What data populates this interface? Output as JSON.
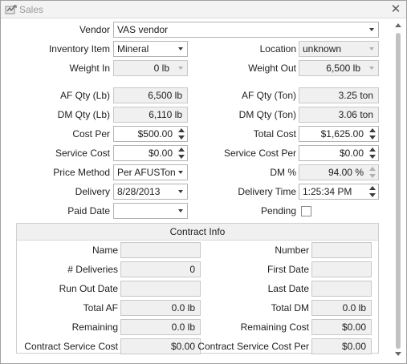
{
  "window": {
    "title": "Sales",
    "title_icon": "sales-form-icon",
    "close_icon": "close-icon"
  },
  "fields": {
    "vendor": {
      "label": "Vendor",
      "value": "VAS vendor"
    },
    "inventory_item": {
      "label": "Inventory Item",
      "value": "Mineral"
    },
    "location": {
      "label": "Location",
      "value": "unknown"
    },
    "weight_in": {
      "label": "Weight In",
      "value": "0 lb"
    },
    "weight_out": {
      "label": "Weight Out",
      "value": "6,500 lb"
    },
    "af_qty_lb": {
      "label": "AF Qty (Lb)",
      "value": "6,500 lb"
    },
    "af_qty_ton": {
      "label": "AF Qty (Ton)",
      "value": "3.25 ton"
    },
    "dm_qty_lb": {
      "label": "DM Qty (Lb)",
      "value": "6,110 lb"
    },
    "dm_qty_ton": {
      "label": "DM Qty (Ton)",
      "value": "3.06 ton"
    },
    "cost_per": {
      "label": "Cost Per",
      "value": "$500.00"
    },
    "total_cost": {
      "label": "Total Cost",
      "value": "$1,625.00"
    },
    "service_cost": {
      "label": "Service Cost",
      "value": "$0.00"
    },
    "service_cost_per": {
      "label": "Service Cost Per",
      "value": "$0.00"
    },
    "price_method": {
      "label": "Price Method",
      "value": "Per AFUSTon"
    },
    "dm_percent": {
      "label": "DM %",
      "value": "94.00 %"
    },
    "delivery": {
      "label": "Delivery",
      "value": "8/28/2013"
    },
    "delivery_time": {
      "label": "Delivery Time",
      "value": "1:25:34 PM"
    },
    "paid_date": {
      "label": "Paid Date",
      "value": ""
    },
    "pending": {
      "label": "Pending",
      "checked": false
    }
  },
  "contract_info": {
    "title": "Contract Info",
    "name": {
      "label": "Name",
      "value": ""
    },
    "number": {
      "label": "Number",
      "value": ""
    },
    "deliveries": {
      "label": "# Deliveries",
      "value": "0"
    },
    "first_date": {
      "label": "First Date",
      "value": ""
    },
    "run_out_date": {
      "label": "Run Out Date",
      "value": ""
    },
    "last_date": {
      "label": "Last Date",
      "value": ""
    },
    "total_af": {
      "label": "Total AF",
      "value": "0.0 lb"
    },
    "total_dm": {
      "label": "Total DM",
      "value": "0.0 lb"
    },
    "remaining": {
      "label": "Remaining",
      "value": "0.0 lb"
    },
    "remaining_cost": {
      "label": "Remaining Cost",
      "value": "$0.00"
    },
    "contract_service_cost": {
      "label": "Contract Service Cost",
      "value": "$0.00"
    },
    "contract_service_cost_per": {
      "label": "Contract Service Cost Per",
      "value": "$0.00"
    }
  }
}
